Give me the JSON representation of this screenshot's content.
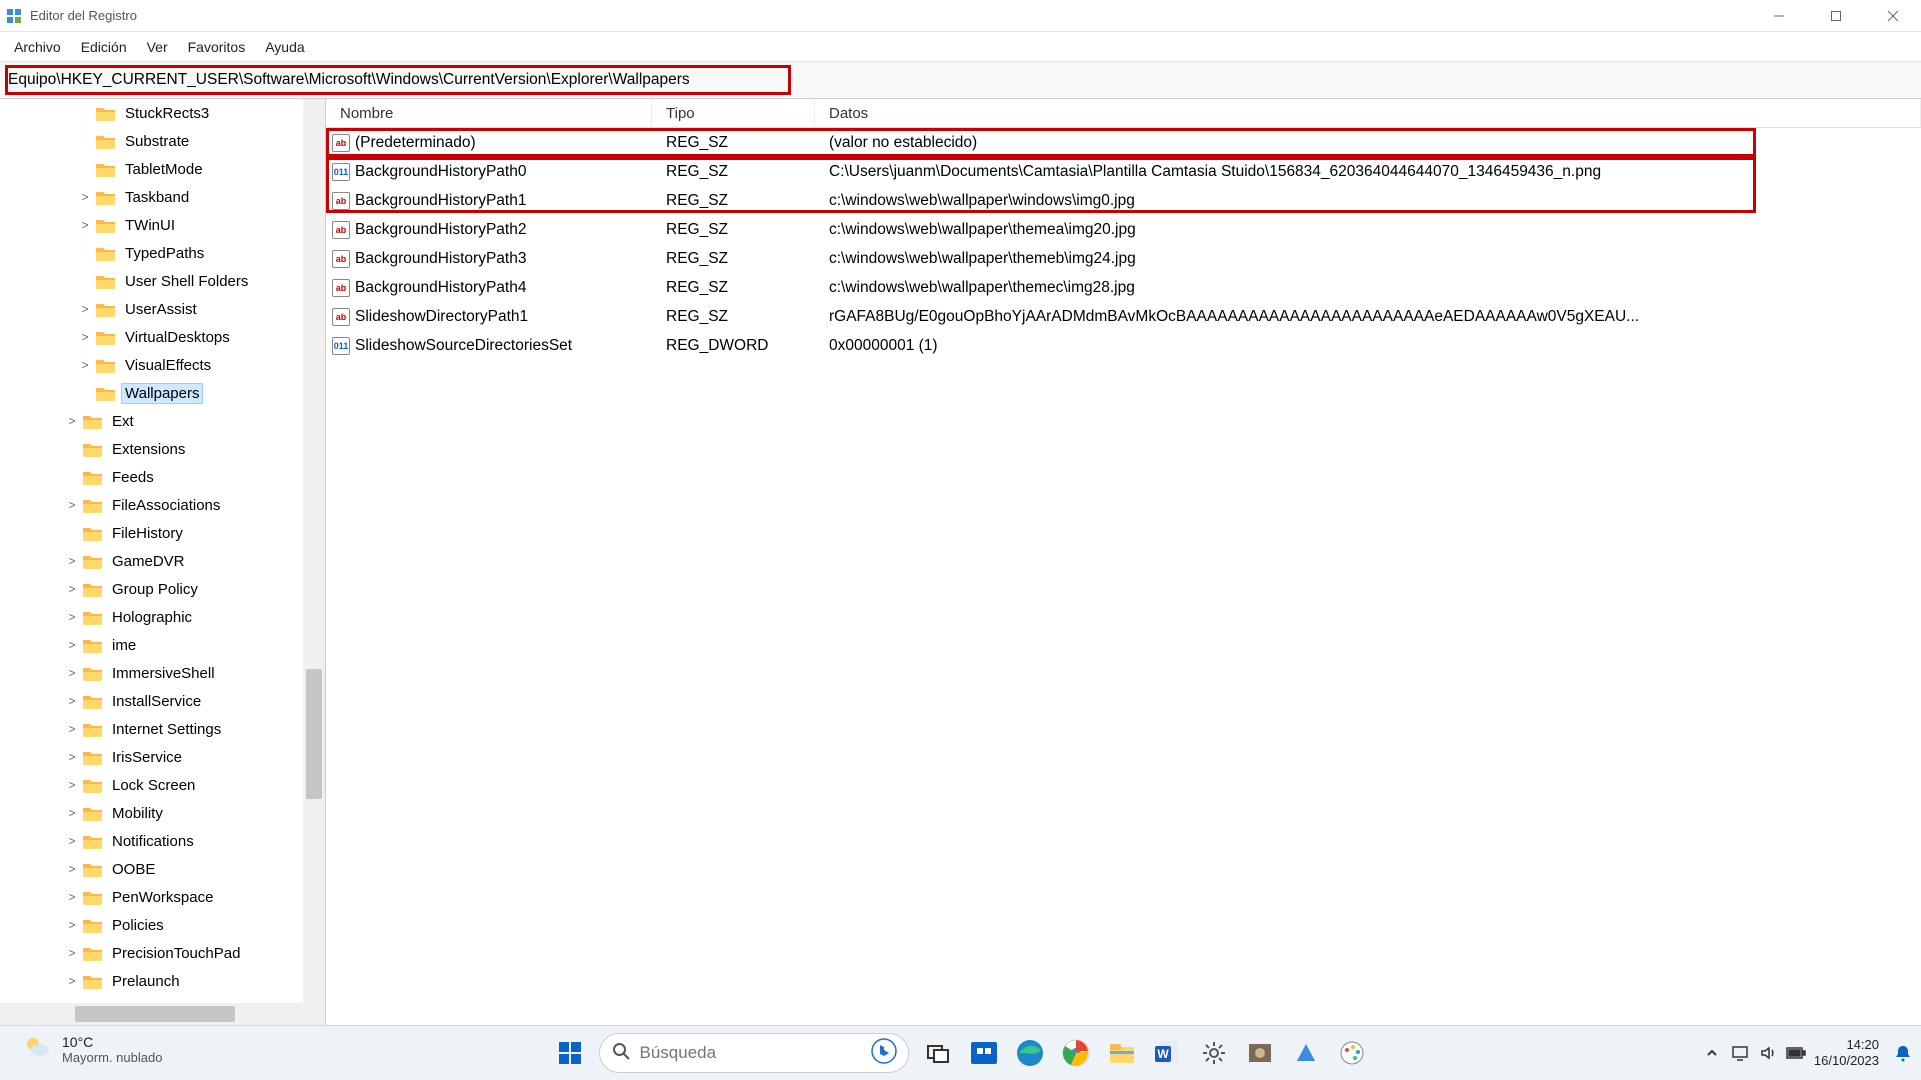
{
  "window": {
    "title": "Editor del Registro"
  },
  "menu": {
    "items": [
      "Archivo",
      "Edición",
      "Ver",
      "Favoritos",
      "Ayuda"
    ]
  },
  "address": "Equipo\\HKEY_CURRENT_USER\\Software\\Microsoft\\Windows\\CurrentVersion\\Explorer\\Wallpapers",
  "tree": [
    {
      "indent": 5,
      "expander": "",
      "label": "StuckRects3"
    },
    {
      "indent": 5,
      "expander": "",
      "label": "Substrate"
    },
    {
      "indent": 5,
      "expander": "",
      "label": "TabletMode"
    },
    {
      "indent": 5,
      "expander": ">",
      "label": "Taskband"
    },
    {
      "indent": 5,
      "expander": ">",
      "label": "TWinUI"
    },
    {
      "indent": 5,
      "expander": "",
      "label": "TypedPaths"
    },
    {
      "indent": 5,
      "expander": "",
      "label": "User Shell Folders"
    },
    {
      "indent": 5,
      "expander": ">",
      "label": "UserAssist"
    },
    {
      "indent": 5,
      "expander": ">",
      "label": "VirtualDesktops"
    },
    {
      "indent": 5,
      "expander": ">",
      "label": "VisualEffects"
    },
    {
      "indent": 5,
      "expander": "",
      "label": "Wallpapers",
      "selected": true
    },
    {
      "indent": 4,
      "expander": ">",
      "label": "Ext"
    },
    {
      "indent": 4,
      "expander": "",
      "label": "Extensions"
    },
    {
      "indent": 4,
      "expander": "",
      "label": "Feeds"
    },
    {
      "indent": 4,
      "expander": ">",
      "label": "FileAssociations"
    },
    {
      "indent": 4,
      "expander": "",
      "label": "FileHistory"
    },
    {
      "indent": 4,
      "expander": ">",
      "label": "GameDVR"
    },
    {
      "indent": 4,
      "expander": ">",
      "label": "Group Policy"
    },
    {
      "indent": 4,
      "expander": ">",
      "label": "Holographic"
    },
    {
      "indent": 4,
      "expander": ">",
      "label": "ime"
    },
    {
      "indent": 4,
      "expander": ">",
      "label": "ImmersiveShell"
    },
    {
      "indent": 4,
      "expander": ">",
      "label": "InstallService"
    },
    {
      "indent": 4,
      "expander": ">",
      "label": "Internet Settings"
    },
    {
      "indent": 4,
      "expander": ">",
      "label": "IrisService"
    },
    {
      "indent": 4,
      "expander": ">",
      "label": "Lock Screen"
    },
    {
      "indent": 4,
      "expander": ">",
      "label": "Mobility"
    },
    {
      "indent": 4,
      "expander": ">",
      "label": "Notifications"
    },
    {
      "indent": 4,
      "expander": ">",
      "label": "OOBE"
    },
    {
      "indent": 4,
      "expander": ">",
      "label": "PenWorkspace"
    },
    {
      "indent": 4,
      "expander": ">",
      "label": "Policies"
    },
    {
      "indent": 4,
      "expander": ">",
      "label": "PrecisionTouchPad"
    },
    {
      "indent": 4,
      "expander": ">",
      "label": "Prelaunch"
    }
  ],
  "columns": {
    "name": "Nombre",
    "type": "Tipo",
    "data": "Datos"
  },
  "values": [
    {
      "icon": "str",
      "name": "(Predeterminado)",
      "type": "REG_SZ",
      "data": "(valor no establecido)"
    },
    {
      "icon": "num",
      "name": "BackgroundHistoryPath0",
      "type": "REG_SZ",
      "data": "C:\\Users\\juanm\\Documents\\Camtasia\\Plantilla Camtasia Stuido\\156834_620364044644070_1346459436_n.png"
    },
    {
      "icon": "str",
      "name": "BackgroundHistoryPath1",
      "type": "REG_SZ",
      "data": "c:\\windows\\web\\wallpaper\\windows\\img0.jpg"
    },
    {
      "icon": "str",
      "name": "BackgroundHistoryPath2",
      "type": "REG_SZ",
      "data": "c:\\windows\\web\\wallpaper\\themea\\img20.jpg"
    },
    {
      "icon": "str",
      "name": "BackgroundHistoryPath3",
      "type": "REG_SZ",
      "data": "c:\\windows\\web\\wallpaper\\themeb\\img24.jpg"
    },
    {
      "icon": "str",
      "name": "BackgroundHistoryPath4",
      "type": "REG_SZ",
      "data": "c:\\windows\\web\\wallpaper\\themec\\img28.jpg"
    },
    {
      "icon": "str",
      "name": "SlideshowDirectoryPath1",
      "type": "REG_SZ",
      "data": "rGAFA8BUg/E0gouOpBhoYjAArADMdmBAvMkOcBAAAAAAAAAAAAAAAAAAAAAAAAeAEDAAAAAAw0V5gXEAU..."
    },
    {
      "icon": "num",
      "name": "SlideshowSourceDirectoriesSet",
      "type": "REG_DWORD",
      "data": "0x00000001 (1)"
    }
  ],
  "taskbar": {
    "weather_temp": "10°C",
    "weather_desc": "Mayorm. nublado",
    "search_placeholder": "Búsqueda",
    "clock_time": "14:20",
    "clock_date": "16/10/2023"
  }
}
